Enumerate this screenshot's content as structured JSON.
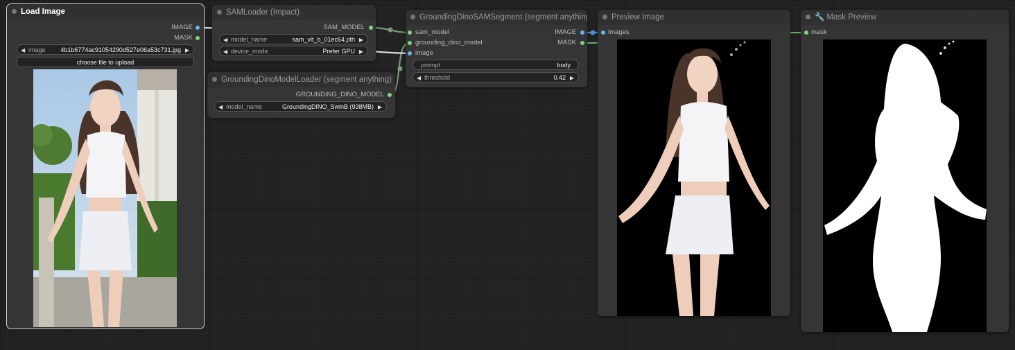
{
  "nodes": {
    "load_image": {
      "title": "Load Image",
      "outputs": [
        "IMAGE",
        "MASK"
      ],
      "widget_label": "image",
      "widget_value": "4b1b6774ac91054290d527e06a53c731.jpg",
      "button": "choose file to upload"
    },
    "sam_loader": {
      "title": "SAMLoader (Impact)",
      "output": "SAM_MODEL",
      "widgets": [
        {
          "label": "model_name",
          "value": "sam_vit_b_01ec64.pth"
        },
        {
          "label": "device_mode",
          "value": "Prefer GPU"
        }
      ]
    },
    "dino_loader": {
      "title": "GroundingDinoModelLoader (segment anything)",
      "output": "GROUNDING_DINO_MODEL",
      "widget": {
        "label": "model_name",
        "value": "GroundingDINO_SwinB (938MB)"
      }
    },
    "dino_segment": {
      "title": "GroundingDinoSAMSegment (segment anything)",
      "inputs": [
        "sam_model",
        "grounding_dino_model",
        "image"
      ],
      "outputs": [
        "IMAGE",
        "MASK"
      ],
      "prompt": {
        "label": "prompt",
        "value": "body"
      },
      "threshold": {
        "label": "threshold",
        "value": "0.42"
      }
    },
    "preview": {
      "title": "Preview Image",
      "input": "images"
    },
    "mask_preview": {
      "title": "Mask Preview",
      "title_icon": "wrench-icon",
      "input": "mask"
    }
  },
  "colors": {
    "canvas": "#222222",
    "node_body": "#353535",
    "slot_green": "#7ed67e",
    "slot_blue": "#64b5f6"
  }
}
